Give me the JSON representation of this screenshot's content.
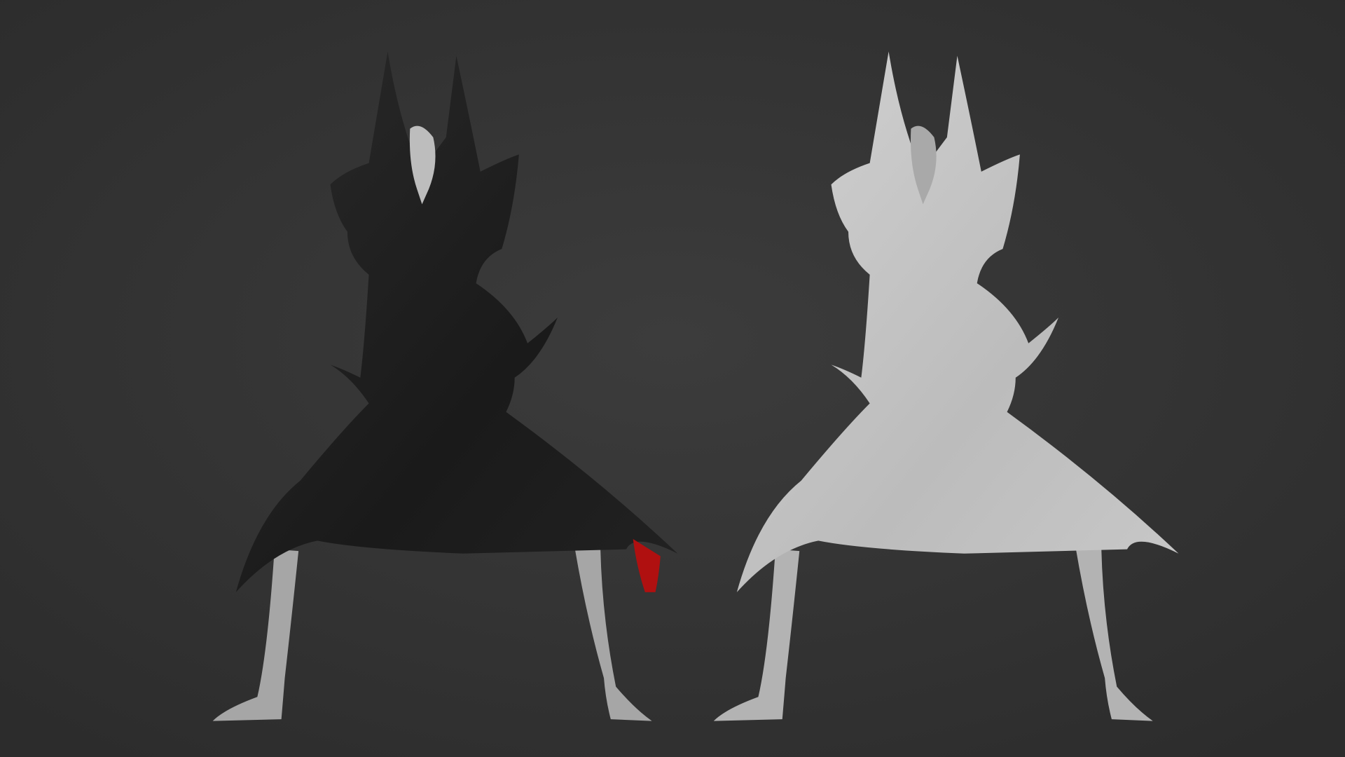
{
  "scene": {
    "background_color": "#383838",
    "vignette_color": "#2a2a2a",
    "figures": [
      {
        "variant": "textured",
        "cloak_color": "#1e1e1e",
        "skin_color": "#a8a8a8",
        "accent_color": "#b01010"
      },
      {
        "variant": "clay",
        "cloak_color": "#c4c4c4",
        "skin_color": "#b5b5b5"
      }
    ]
  }
}
